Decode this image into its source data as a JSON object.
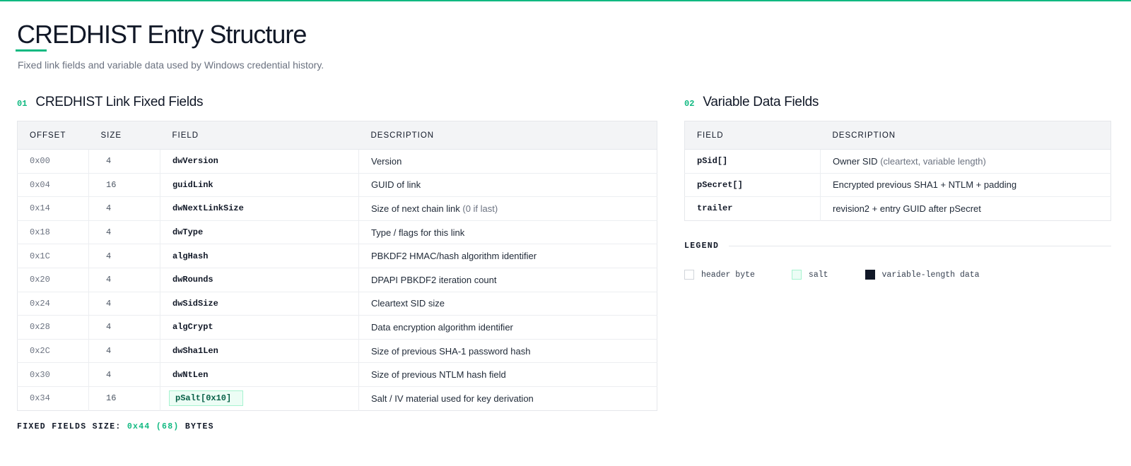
{
  "header": {
    "title": "CREDHIST Entry Structure",
    "subtitle": "Fixed link fields and variable data used by Windows credential history."
  },
  "fixed_section": {
    "number": "01",
    "title": "CREDHIST Link Fixed Fields",
    "columns": [
      "OFFSET",
      "SIZE",
      "FIELD",
      "DESCRIPTION"
    ],
    "rows": [
      {
        "offset": "0x00",
        "size": "4",
        "field": "dwVersion",
        "desc": "Version",
        "note": ""
      },
      {
        "offset": "0x04",
        "size": "16",
        "field": "guidLink",
        "desc": "GUID of link",
        "note": ""
      },
      {
        "offset": "0x14",
        "size": "4",
        "field": "dwNextLinkSize",
        "desc": "Size of next chain link",
        "note": "(0 if last)"
      },
      {
        "offset": "0x18",
        "size": "4",
        "field": "dwType",
        "desc": "Type / flags for this link",
        "note": ""
      },
      {
        "offset": "0x1C",
        "size": "4",
        "field": "algHash",
        "desc": "PBKDF2 HMAC/hash algorithm identifier",
        "note": ""
      },
      {
        "offset": "0x20",
        "size": "4",
        "field": "dwRounds",
        "desc": "DPAPI PBKDF2 iteration count",
        "note": ""
      },
      {
        "offset": "0x24",
        "size": "4",
        "field": "dwSidSize",
        "desc": "Cleartext SID size",
        "note": ""
      },
      {
        "offset": "0x28",
        "size": "4",
        "field": "algCrypt",
        "desc": "Data encryption algorithm identifier",
        "note": ""
      },
      {
        "offset": "0x2C",
        "size": "4",
        "field": "dwSha1Len",
        "desc": "Size of previous SHA-1 password hash",
        "note": ""
      },
      {
        "offset": "0x30",
        "size": "4",
        "field": "dwNtLen",
        "desc": "Size of previous NTLM hash field",
        "note": ""
      },
      {
        "offset": "0x34",
        "size": "16",
        "field": "pSalt[0x10]",
        "desc": "Salt / IV material used for key derivation",
        "note": ""
      }
    ],
    "footer_label": "FIXED FIELDS SIZE:",
    "footer_value": "0x44 (68)",
    "footer_unit": "BYTES"
  },
  "variable_section": {
    "number": "02",
    "title": "Variable Data Fields",
    "columns": [
      "FIELD",
      "DESCRIPTION"
    ],
    "rows": [
      {
        "field": "pSid[]",
        "desc": "Owner SID",
        "note": "(cleartext, variable length)"
      },
      {
        "field": "pSecret[]",
        "desc": "Encrypted previous SHA1 + NTLM + padding",
        "note": ""
      },
      {
        "field": "trailer",
        "desc": "revision2 + entry GUID after pSecret",
        "note": ""
      }
    ]
  },
  "legend": {
    "title": "LEGEND",
    "items": [
      "header byte",
      "salt",
      "variable-length data"
    ]
  },
  "colors": {
    "accent": "#10b981",
    "salt_fill": "#ecfdf5",
    "variable_fill": "#111827"
  }
}
